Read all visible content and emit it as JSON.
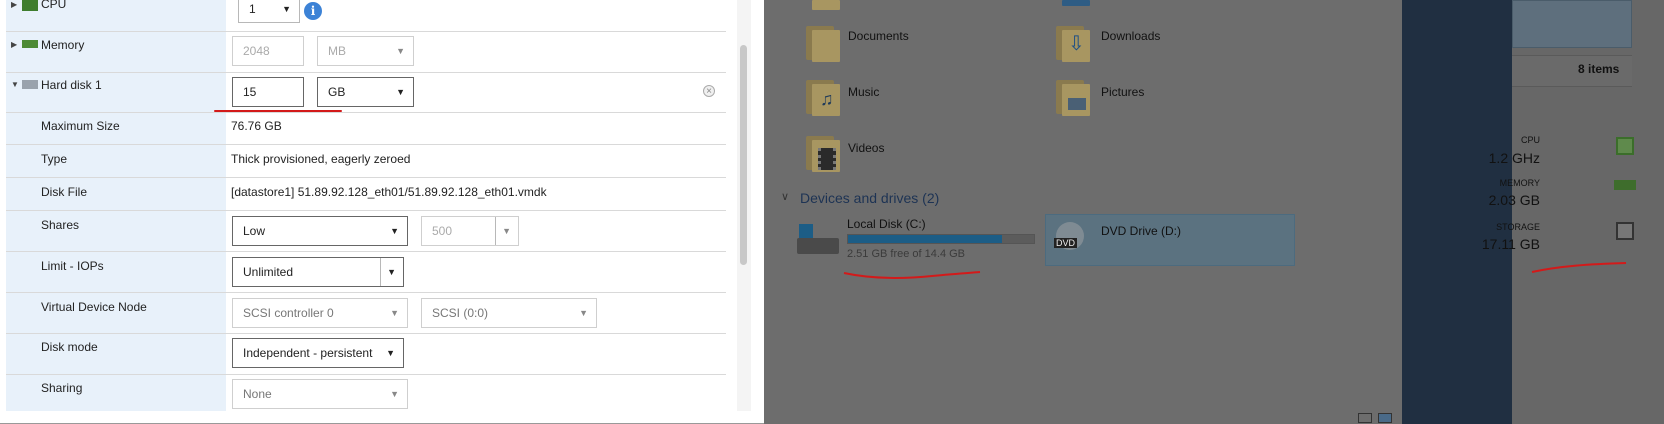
{
  "vm_settings": {
    "cpu": {
      "label": "CPU",
      "value": "1"
    },
    "memory": {
      "label": "Memory",
      "value": "2048",
      "unit": "MB"
    },
    "hard_disk": {
      "label": "Hard disk 1",
      "value": "15",
      "unit": "GB",
      "maximum_size": {
        "label": "Maximum Size",
        "value": "76.76 GB"
      },
      "type": {
        "label": "Type",
        "value": "Thick provisioned, eagerly zeroed"
      },
      "disk_file": {
        "label": "Disk File",
        "value": "[datastore1] 51.89.92.128_eth01/51.89.92.128_eth01.vmdk"
      },
      "shares": {
        "label": "Shares",
        "value": "Low",
        "amount": "500"
      },
      "limit_iops": {
        "label": "Limit - IOPs",
        "value": "Unlimited"
      },
      "virtual_device_node": {
        "label": "Virtual Device Node",
        "controller": "SCSI controller 0",
        "slot": "SCSI (0:0)"
      },
      "disk_mode": {
        "label": "Disk mode",
        "value": "Independent - persistent"
      },
      "sharing": {
        "label": "Sharing",
        "value": "None"
      }
    }
  },
  "explorer": {
    "folders": [
      "Documents",
      "Downloads",
      "Music",
      "Pictures",
      "Videos"
    ],
    "devices_section": "Devices and drives (2)",
    "local_disk": {
      "name": "Local Disk (C:)",
      "free_text": "2.51 GB free of 14.4 GB",
      "used_fraction": 0.826
    },
    "dvd_drive": {
      "name": "DVD Drive (D:)",
      "icon_text": "DVD"
    }
  },
  "resources": {
    "items_count": "8 items",
    "cpu": {
      "label": "CPU",
      "value": "1.2 GHz"
    },
    "memory": {
      "label": "MEMORY",
      "value": "2.03 GB"
    },
    "storage": {
      "label": "STORAGE",
      "value": "17.11 GB"
    }
  },
  "colors": {
    "label_column_bg": "#e8f1fa",
    "annotation_red": "#d31a1a",
    "info_blue": "#3c82d6",
    "drive_bar": "#1c5d86"
  }
}
